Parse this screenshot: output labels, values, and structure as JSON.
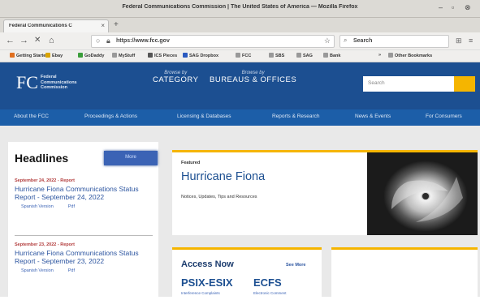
{
  "window": {
    "title": "Federal Communications Commission | The United States of America — Mozilla Firefox",
    "controls": {
      "minimize": "–",
      "maximize": "▫",
      "close": "⊗"
    }
  },
  "tab": {
    "label": "Federal Communications C",
    "close": "×",
    "new_tab": "+"
  },
  "navbar": {
    "back": "←",
    "forward": "→",
    "reload": "✕",
    "home": "⌂",
    "url": "https://www.fcc.gov",
    "search_placeholder": "Search",
    "library_icon": "⊞",
    "menu_icon": "≡",
    "star": "☆"
  },
  "bookmarks": [
    {
      "label": "Getting Started",
      "color": "#e07020"
    },
    {
      "label": "Ebay",
      "color": "#d9a400"
    },
    {
      "label": "GoDaddy",
      "color": "#3b9e3b"
    },
    {
      "label": "MyStuff",
      "color": "#999999"
    },
    {
      "label": "ICS Pieces",
      "color": "#555555"
    },
    {
      "label": "SAG Dropbox",
      "color": "#2a5ac0"
    },
    {
      "label": "FCC",
      "color": "#999999"
    },
    {
      "label": "SBS",
      "color": "#999999"
    },
    {
      "label": "SAG",
      "color": "#999999"
    },
    {
      "label": "Bank",
      "color": "#999999"
    },
    {
      "label": "Other Bookmarks",
      "color": "#999999"
    }
  ],
  "bookmarks_overflow": "»",
  "site": {
    "logo": "FC",
    "org_name_lines": [
      "Federal",
      "Communications",
      "Commission"
    ],
    "browse_category_small": "Browse by",
    "browse_category": "CATEGORY",
    "browse_bureaus_small": "Browse by",
    "browse_bureaus": "BUREAUS & OFFICES",
    "search_placeholder": "Search",
    "nav": [
      "About the FCC",
      "Proceedings & Actions",
      "Licensing & Databases",
      "Reports & Research",
      "News & Events",
      "For Consumers"
    ]
  },
  "headlines": {
    "title": "Headlines",
    "more_button": "More",
    "items": [
      {
        "meta": "September 24, 2022 - Report",
        "title": "Hurricane Fiona Communications Status Report - September 24, 2022",
        "links": [
          "Spanish Version",
          "Pdf"
        ]
      },
      {
        "meta": "September 23, 2022 - Report",
        "title": "Hurricane Fiona Communications Status Report - September 23, 2022",
        "links": [
          "Spanish Version",
          "Pdf"
        ]
      }
    ]
  },
  "featured": {
    "label": "Featured",
    "title": "Hurricane Fiona",
    "subtitle": "Notices, Updates, Tips and Resources"
  },
  "access": {
    "title": "Access Now",
    "see_more": "See More",
    "systems": [
      {
        "name": "PSIX-ESIX",
        "desc": "Interference Complaints"
      },
      {
        "name": "ECFS",
        "desc": "Electronic Comment"
      }
    ]
  }
}
